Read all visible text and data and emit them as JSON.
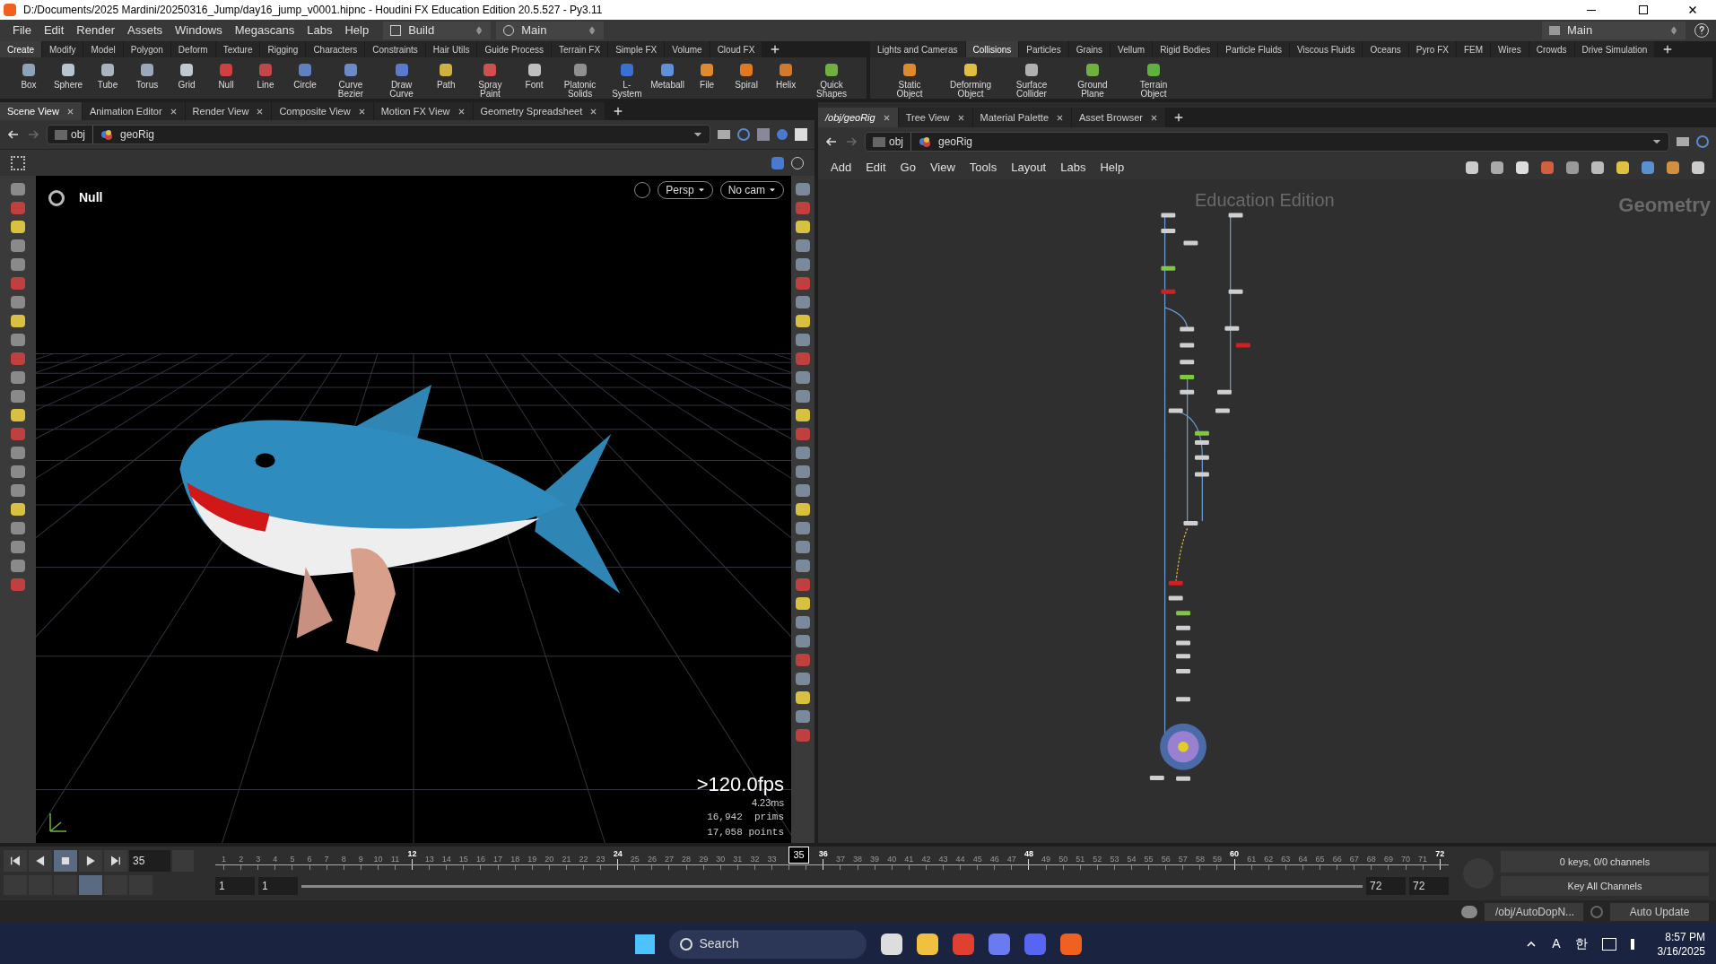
{
  "window": {
    "title": "D:/Documents/2025 Mardini/20250316_Jump/day16_jump_v0001.hipnc - Houdini FX Education Edition 20.5.527 - Py3.11"
  },
  "menu": [
    "File",
    "Edit",
    "Render",
    "Assets",
    "Windows",
    "Megascans",
    "Labs",
    "Help"
  ],
  "desktop": {
    "build": "Build",
    "main": "Main",
    "right_main": "Main"
  },
  "shelf_left": {
    "tabs": [
      {
        "label": "Create",
        "selected": true
      },
      {
        "label": "Modify",
        "selected": false
      },
      {
        "label": "Model",
        "selected": false
      },
      {
        "label": "Polygon",
        "selected": false
      },
      {
        "label": "Deform",
        "selected": false
      },
      {
        "label": "Texture",
        "selected": false
      },
      {
        "label": "Rigging",
        "selected": false
      },
      {
        "label": "Characters",
        "selected": false
      },
      {
        "label": "Constraints",
        "selected": false
      },
      {
        "label": "Hair Utils",
        "selected": false
      },
      {
        "label": "Guide Process",
        "selected": false
      },
      {
        "label": "Terrain FX",
        "selected": false
      },
      {
        "label": "Simple FX",
        "selected": false
      },
      {
        "label": "Volume",
        "selected": false
      },
      {
        "label": "Cloud FX",
        "selected": false
      }
    ],
    "tools": [
      {
        "label": "Box",
        "color": "#8fa3b8"
      },
      {
        "label": "Sphere",
        "color": "#b8c4d0"
      },
      {
        "label": "Tube",
        "color": "#a8b4c0"
      },
      {
        "label": "Torus",
        "color": "#9aa8b8"
      },
      {
        "label": "Grid",
        "color": "#c0c8d0"
      },
      {
        "label": "Null",
        "color": "#d04040"
      },
      {
        "label": "Line",
        "color": "#c04848"
      },
      {
        "label": "Circle",
        "color": "#6080c0"
      },
      {
        "label": "Curve Bezier",
        "color": "#6a8ac8"
      },
      {
        "label": "Draw Curve",
        "color": "#5a7ad0"
      },
      {
        "label": "Path",
        "color": "#d0b040"
      },
      {
        "label": "Spray Paint",
        "color": "#d05050"
      },
      {
        "label": "Font",
        "color": "#c0c0c0"
      },
      {
        "label": "Platonic Solids",
        "color": "#909090"
      },
      {
        "label": "L-System",
        "color": "#3a70d0"
      },
      {
        "label": "Metaball",
        "color": "#6090d8"
      },
      {
        "label": "File",
        "color": "#e08a30"
      },
      {
        "label": "Spiral",
        "color": "#e07a20"
      },
      {
        "label": "Helix",
        "color": "#d07a30"
      },
      {
        "label": "Quick Shapes",
        "color": "#70b040"
      }
    ]
  },
  "shelf_right": {
    "tabs": [
      {
        "label": "Lights and Cameras",
        "selected": false
      },
      {
        "label": "Collisions",
        "selected": true
      },
      {
        "label": "Particles",
        "selected": false
      },
      {
        "label": "Grains",
        "selected": false
      },
      {
        "label": "Vellum",
        "selected": false
      },
      {
        "label": "Rigid Bodies",
        "selected": false
      },
      {
        "label": "Particle Fluids",
        "selected": false
      },
      {
        "label": "Viscous Fluids",
        "selected": false
      },
      {
        "label": "Oceans",
        "selected": false
      },
      {
        "label": "Pyro FX",
        "selected": false
      },
      {
        "label": "FEM",
        "selected": false
      },
      {
        "label": "Wires",
        "selected": false
      },
      {
        "label": "Crowds",
        "selected": false
      },
      {
        "label": "Drive Simulation",
        "selected": false
      }
    ],
    "tools": [
      {
        "label": "Static Object",
        "color": "#e08a30"
      },
      {
        "label": "Deforming Object",
        "color": "#e0c040"
      },
      {
        "label": "Surface Collider",
        "color": "#b0b0b0"
      },
      {
        "label": "Ground Plane",
        "color": "#70b040"
      },
      {
        "label": "Terrain Object",
        "color": "#60b040"
      }
    ]
  },
  "scene_pane": {
    "tabs": [
      {
        "label": "Scene View",
        "selected": true
      },
      {
        "label": "Animation Editor",
        "selected": false
      },
      {
        "label": "Render View",
        "selected": false
      },
      {
        "label": "Composite View",
        "selected": false
      },
      {
        "label": "Motion FX View",
        "selected": false
      },
      {
        "label": "Geometry Spreadsheet",
        "selected": false
      }
    ],
    "path": [
      "obj",
      "geoRig"
    ],
    "viewport": {
      "selected_node": "Null",
      "camera_buttons": [
        "Persp",
        "No cam"
      ],
      "fps": ">120.0fps",
      "time": "4.23ms",
      "stats": [
        "16,942  prims",
        "17,058 points"
      ]
    }
  },
  "network_pane": {
    "tabs": [
      {
        "label": "/obj/geoRig",
        "selected": true
      },
      {
        "label": "Tree View",
        "selected": false
      },
      {
        "label": "Material Palette",
        "selected": false
      },
      {
        "label": "Asset Browser",
        "selected": false
      }
    ],
    "path": [
      "obj",
      "geoRig"
    ],
    "menu": [
      "Add",
      "Edit",
      "Go",
      "View",
      "Tools",
      "Layout",
      "Labs",
      "Help"
    ],
    "overlay": "Education Edition",
    "context": "Geometry"
  },
  "timeline": {
    "current_frame": "35",
    "frame_field": "35",
    "range_start": [
      "1",
      "1"
    ],
    "range_end": [
      "72",
      "72"
    ],
    "range_bar": {
      "level": 1
    },
    "ticks": [
      {
        "label": "1",
        "major": false
      },
      {
        "label": "2",
        "major": false
      },
      {
        "label": "3",
        "major": false
      },
      {
        "label": "4",
        "major": false
      },
      {
        "label": "5",
        "major": false
      },
      {
        "label": "6",
        "major": false
      },
      {
        "label": "7",
        "major": false
      },
      {
        "label": "8",
        "major": false
      },
      {
        "label": "9",
        "major": false
      },
      {
        "label": "10",
        "major": false
      },
      {
        "label": "11",
        "major": false
      },
      {
        "label": "12",
        "major": true
      },
      {
        "label": "13",
        "major": false
      },
      {
        "label": "14",
        "major": false
      },
      {
        "label": "15",
        "major": false
      },
      {
        "label": "16",
        "major": false
      },
      {
        "label": "17",
        "major": false
      },
      {
        "label": "18",
        "major": false
      },
      {
        "label": "19",
        "major": false
      },
      {
        "label": "20",
        "major": false
      },
      {
        "label": "21",
        "major": false
      },
      {
        "label": "22",
        "major": false
      },
      {
        "label": "23",
        "major": false
      },
      {
        "label": "24",
        "major": true
      },
      {
        "label": "25",
        "major": false
      },
      {
        "label": "26",
        "major": false
      },
      {
        "label": "27",
        "major": false
      },
      {
        "label": "28",
        "major": false
      },
      {
        "label": "29",
        "major": false
      },
      {
        "label": "30",
        "major": false
      },
      {
        "label": "31",
        "major": false
      },
      {
        "label": "32",
        "major": false
      },
      {
        "label": "33",
        "major": false
      },
      {
        "major": false
      },
      {
        "major": false
      },
      {
        "label": "36",
        "major": true
      },
      {
        "label": "37",
        "major": false
      },
      {
        "label": "38",
        "major": false
      },
      {
        "label": "39",
        "major": false
      },
      {
        "label": "40",
        "major": false
      },
      {
        "label": "41",
        "major": false
      },
      {
        "label": "42",
        "major": false
      },
      {
        "label": "43",
        "major": false
      },
      {
        "label": "44",
        "major": false
      },
      {
        "label": "45",
        "major": false
      },
      {
        "label": "46",
        "major": false
      },
      {
        "label": "47",
        "major": false
      },
      {
        "label": "48",
        "major": true
      },
      {
        "label": "49",
        "major": false
      },
      {
        "label": "50",
        "major": false
      },
      {
        "label": "51",
        "major": false
      },
      {
        "label": "52",
        "major": false
      },
      {
        "label": "53",
        "major": false
      },
      {
        "label": "54",
        "major": false
      },
      {
        "label": "55",
        "major": false
      },
      {
        "label": "56",
        "major": false
      },
      {
        "label": "57",
        "major": false
      },
      {
        "label": "58",
        "major": false
      },
      {
        "label": "59",
        "major": false
      },
      {
        "label": "60",
        "major": true
      },
      {
        "label": "61",
        "major": false
      },
      {
        "label": "62",
        "major": false
      },
      {
        "label": "63",
        "major": false
      },
      {
        "label": "64",
        "major": false
      },
      {
        "label": "65",
        "major": false
      },
      {
        "label": "66",
        "major": false
      },
      {
        "label": "67",
        "major": false
      },
      {
        "label": "68",
        "major": false
      },
      {
        "label": "69",
        "major": false
      },
      {
        "label": "70",
        "major": false
      },
      {
        "label": "71",
        "major": false
      },
      {
        "label": "72",
        "major": true
      }
    ],
    "keys": "0 keys, 0/0 channels",
    "key_mode": "Key All Channels"
  },
  "status_bar": {
    "sim_path": "/obj/AutoDopN...",
    "update_mode": "Auto Update"
  },
  "taskbar": {
    "search": "Search",
    "tray": [
      "A",
      "한"
    ],
    "time": "8:57 PM",
    "date": "3/16/2025"
  }
}
